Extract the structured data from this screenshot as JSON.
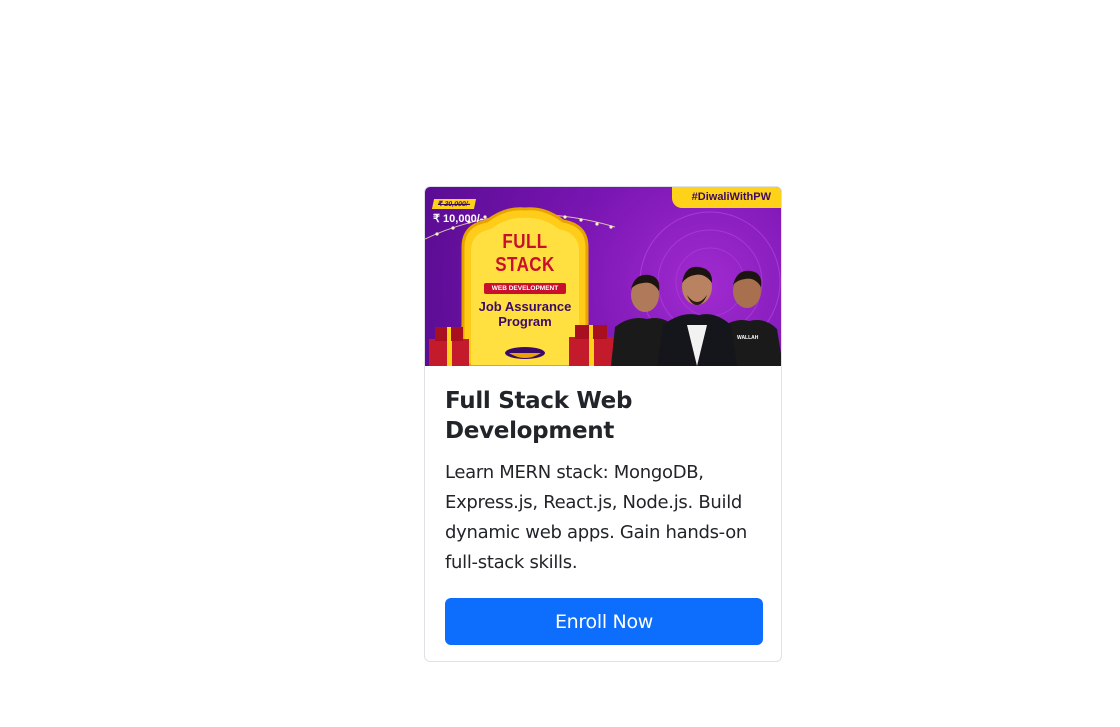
{
  "course_card": {
    "banner": {
      "hashtag": "#DiwaliWithPW",
      "price_old": "₹ 20,000/-",
      "price_new": "₹ 10,000/-",
      "headline": "FULL STACK",
      "ribbon": "WEB DEVELOPMENT",
      "subtitle": "Job Assurance Program",
      "shirt_text": "WALLAH"
    },
    "title": "Full Stack Web Development",
    "description": "Learn MERN stack: MongoDB, Express.js, React.js, Node.js. Build dynamic web apps. Gain hands-on full-stack skills.",
    "button_label": "Enroll Now",
    "colors": {
      "primary": "#0d6efd",
      "banner_purple": "#7a16b3",
      "banner_yellow": "#ffd21a",
      "accent_red": "#c8102e"
    }
  }
}
